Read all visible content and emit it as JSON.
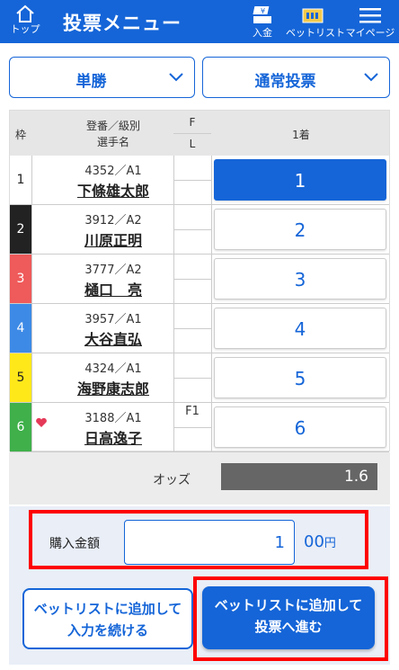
{
  "header": {
    "home_label": "トップ",
    "title": "投票メニュー",
    "deposit_label": "入金",
    "betlist_label": "ベットリスト",
    "mypage_label": "マイページ"
  },
  "selects": {
    "bet_type": "単勝",
    "bet_method": "通常投票"
  },
  "table": {
    "col_waku": "枠",
    "col_racer_line1": "登番／級別",
    "col_racer_line2": "選手名",
    "col_f": "F",
    "col_l": "L",
    "col_first": "1着",
    "rows": [
      {
        "waku": "1",
        "reg": "4352／A1",
        "name": "下條雄太郎",
        "f": "",
        "pick": "1",
        "color": "#ffffff",
        "text_color": "#222222",
        "selected": true,
        "favorite": false
      },
      {
        "waku": "2",
        "reg": "3912／A2",
        "name": "川原正明",
        "f": "",
        "pick": "2",
        "color": "#222222",
        "text_color": "#ffffff",
        "selected": false,
        "favorite": false
      },
      {
        "waku": "3",
        "reg": "3777／A2",
        "name": "樋口　亮",
        "f": "",
        "pick": "3",
        "color": "#ef5a5a",
        "text_color": "#ffffff",
        "selected": false,
        "favorite": false
      },
      {
        "waku": "4",
        "reg": "3957／A1",
        "name": "大谷直弘",
        "f": "",
        "pick": "4",
        "color": "#3d8ae6",
        "text_color": "#ffffff",
        "selected": false,
        "favorite": false
      },
      {
        "waku": "5",
        "reg": "4324／A1",
        "name": "海野康志郎",
        "f": "",
        "pick": "5",
        "color": "#ffe81a",
        "text_color": "#222222",
        "selected": false,
        "favorite": false
      },
      {
        "waku": "6",
        "reg": "3188／A1",
        "name": "日高逸子",
        "f": "F1",
        "pick": "6",
        "color": "#3fb04a",
        "text_color": "#ffffff",
        "selected": false,
        "favorite": true
      }
    ],
    "odds_label": "オッズ",
    "odds_value": "1.6"
  },
  "purchase": {
    "label": "購入金額",
    "value": "1",
    "suffix_main": "00",
    "suffix_unit": "円"
  },
  "buttons": {
    "continue_line1": "ベットリストに追加して",
    "continue_line2": "入力を続ける",
    "proceed_line1": "ベットリストに追加して",
    "proceed_line2": "投票へ進む"
  },
  "colors": {
    "accent": "#1565d8",
    "highlight_frame": "#ff0000"
  }
}
